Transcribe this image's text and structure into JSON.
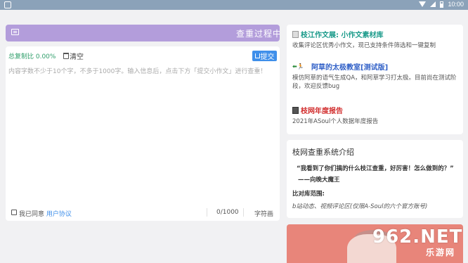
{
  "status_bar": {
    "time": "10:00"
  },
  "banner": {
    "text": "查重过程中遇"
  },
  "editor": {
    "rate_label": "总复制比 0.00%",
    "clear_label": "清空",
    "submit_label": "提交",
    "placeholder": "内容字数不少于10个字，不多于1000字。输入信息后，点击下方「提交小作文」进行查重！",
    "agree_prefix": "我已同意",
    "agree_link": "用户协议",
    "char_count": "0/1000",
    "unit_label": "字符画"
  },
  "links": [
    {
      "title": "枝江作文展: 小作文素材库",
      "color": "#1a9a8a",
      "icon": "document-icon",
      "desc": "收集评论区优秀小作文，现已支持条件筛选和一键复制"
    },
    {
      "title": "阿草的太极教室[测试版]",
      "color": "#2f5fc7",
      "icon": "running-figure-icon",
      "prefix": "⬅",
      "desc": "模仿阿草的语气生成QA，和阿草学习打太极。目前尚在测试阶段，欢迎反馈bug"
    },
    {
      "title": "枝网年度报告",
      "color": "#d22f2f",
      "icon": "report-icon",
      "desc": "2021年ASoul个人数据年度报告"
    }
  ],
  "intro": {
    "heading": "枝网查重系统介绍",
    "quote": "“我看到了你们搞的什么枝江查重，好厉害！怎么做到的？”",
    "author": "——向晚大魔王",
    "scope_title": "比对库范围:",
    "scope": "b站动态、视频评论区(仅限A-Soul的六个官方账号)"
  },
  "watermark": {
    "big": "962.NET",
    "small": "乐游网"
  }
}
